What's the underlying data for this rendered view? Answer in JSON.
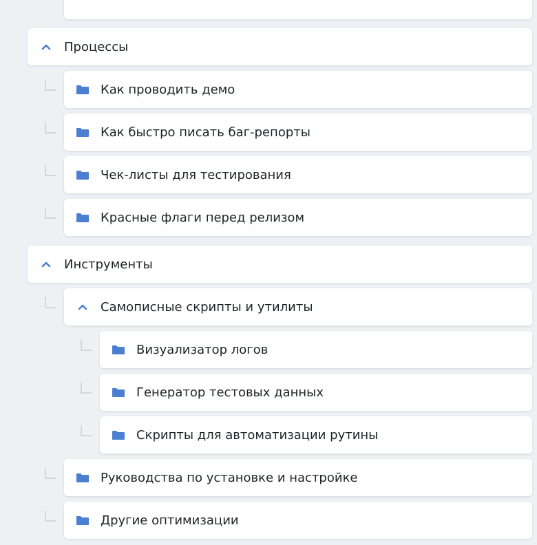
{
  "colors": {
    "accent": "#4a7fd1",
    "connector": "#d2d6dd"
  },
  "tree": {
    "processes": {
      "label": "Процессы",
      "icon": "chevron-up-icon",
      "items": [
        {
          "label": "Как проводить демо",
          "icon": "folder-icon"
        },
        {
          "label": "Как быстро писать баг-репорты",
          "icon": "folder-icon"
        },
        {
          "label": "Чек-листы для тестирования",
          "icon": "folder-icon"
        },
        {
          "label": "Красные флаги перед релизом",
          "icon": "folder-icon"
        }
      ]
    },
    "tools": {
      "label": "Инструменты",
      "icon": "chevron-up-icon",
      "subgroup": {
        "label": "Самописные скрипты и утилиты",
        "icon": "chevron-up-icon",
        "items": [
          {
            "label": "Визуализатор логов",
            "icon": "folder-icon"
          },
          {
            "label": "Генератор тестовых данных",
            "icon": "folder-icon"
          },
          {
            "label": "Скрипты для автоматизации рутины",
            "icon": "folder-icon"
          }
        ]
      },
      "items": [
        {
          "label": "Руководства по установке и настройке",
          "icon": "folder-icon"
        },
        {
          "label": "Другие оптимизации",
          "icon": "folder-icon"
        }
      ]
    }
  }
}
